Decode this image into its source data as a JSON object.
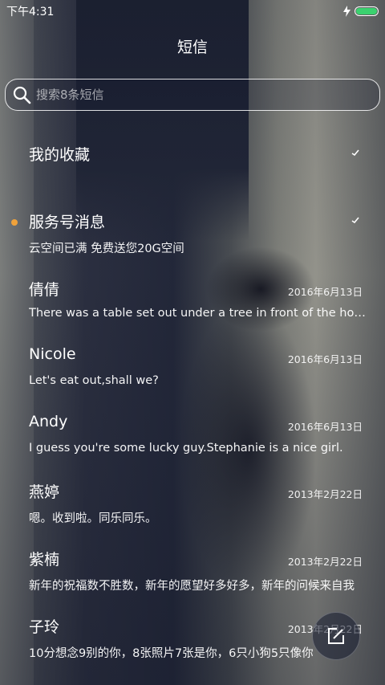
{
  "status_bar": {
    "time": "下午4:31",
    "battery_level": 1.0,
    "charging": true
  },
  "header": {
    "title": "短信"
  },
  "search": {
    "placeholder": "搜索8条短信"
  },
  "threads": [
    {
      "name": "我的收藏",
      "preview": "",
      "date": "",
      "read_mark": true,
      "unread_dot": false
    },
    {
      "name": "服务号消息",
      "preview": "云空间已满 免费送您20G空间",
      "date": "",
      "read_mark": true,
      "unread_dot": true
    },
    {
      "name": "倩倩",
      "preview": "There was a table set out under a tree in front of the house",
      "date": "2016年6月13日",
      "read_mark": false,
      "unread_dot": false
    },
    {
      "name": "Nicole",
      "preview": "Let's eat out,shall we?",
      "date": "2016年6月13日",
      "read_mark": false,
      "unread_dot": false
    },
    {
      "name": "Andy",
      "preview": "I guess you're some lucky guy.Stephanie is a nice girl.",
      "date": "2016年6月13日",
      "read_mark": false,
      "unread_dot": false
    },
    {
      "name": "燕婷",
      "preview": "嗯。收到啦。同乐同乐。",
      "date": "2013年2月22日",
      "read_mark": false,
      "unread_dot": false
    },
    {
      "name": "紫楠",
      "preview": "新年的祝福数不胜数，新年的愿望好多好多，新年的问候来自我",
      "date": "2013年2月22日",
      "read_mark": false,
      "unread_dot": false
    },
    {
      "name": "子玲",
      "preview": "10分想念9别的你，8张照片7张是你，6只小狗5只像你",
      "date": "2013年2月22日",
      "read_mark": false,
      "unread_dot": false
    }
  ],
  "colors": {
    "unread_dot": "#f0a23a",
    "battery_fill": "#3bd16f"
  },
  "icons": {
    "search": "search-icon",
    "compose": "compose-icon",
    "charging": "lightning-icon",
    "read_mark": "check-icon"
  }
}
